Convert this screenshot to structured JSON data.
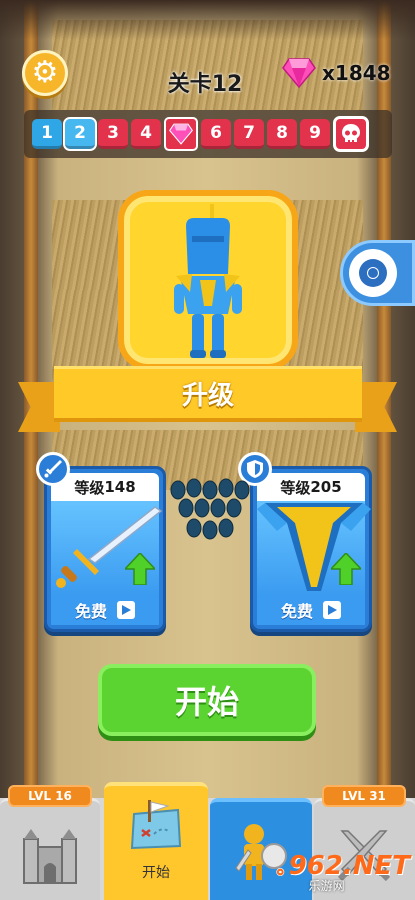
{
  "hud": {
    "level_label": "关卡12",
    "gem_count": "x1848"
  },
  "level_progress": {
    "current": 2,
    "items": [
      {
        "label": "1",
        "state": "done"
      },
      {
        "label": "2",
        "state": "current"
      },
      {
        "label": "3",
        "state": "locked"
      },
      {
        "label": "4",
        "state": "locked"
      },
      {
        "label": "",
        "state": "gem",
        "icon": "gem-icon"
      },
      {
        "label": "6",
        "state": "locked"
      },
      {
        "label": "7",
        "state": "locked"
      },
      {
        "label": "8",
        "state": "locked"
      },
      {
        "label": "9",
        "state": "locked"
      },
      {
        "label": "",
        "state": "boss",
        "icon": "skull-icon"
      }
    ]
  },
  "upgrade_banner": "升级",
  "weapon_card": {
    "level_label": "等级",
    "level_value": "148",
    "free_label": "免费",
    "badge_icon": "sword-icon"
  },
  "armor_card": {
    "level_label": "等级",
    "level_value": "205",
    "free_label": "免费",
    "badge_icon": "shield-icon"
  },
  "start_button": "开始",
  "bottom_nav": {
    "castle_tag": "LVL 16",
    "start_label": "开始",
    "battle_tag": "LVL 31"
  },
  "watermark": {
    "logo": "962.NET",
    "sub": "乐游网"
  },
  "colors": {
    "accent_yellow": "#ffc928",
    "start_green": "#5bd431",
    "card_blue": "#2b7ed8",
    "level_red": "#e2324c",
    "level_blue": "#2fa6e6"
  }
}
